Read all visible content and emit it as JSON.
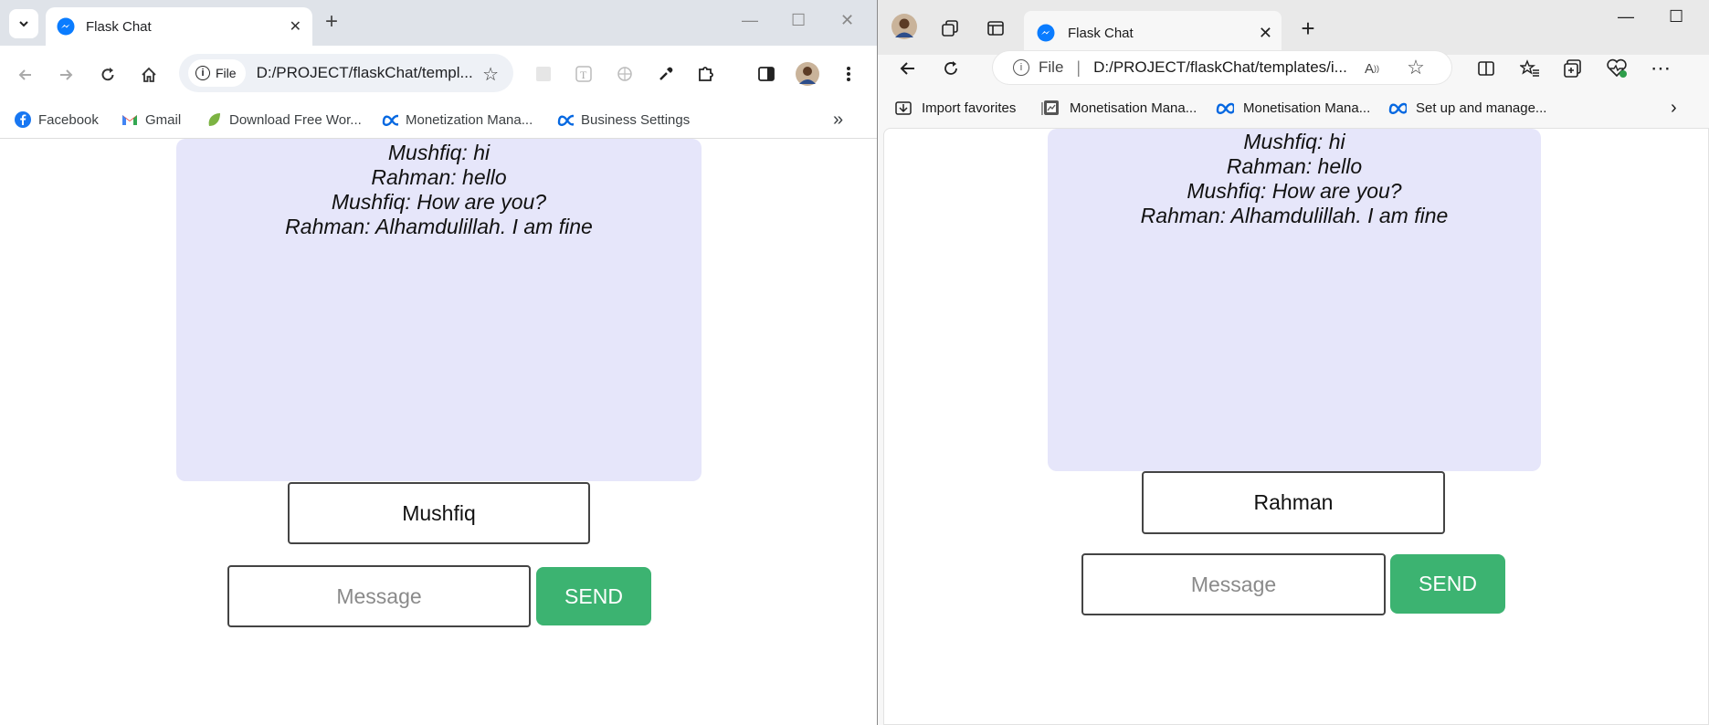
{
  "chrome": {
    "tab_title": "Flask Chat",
    "address_chip": "File",
    "url": "D:/PROJECT/flaskChat/templ...",
    "bookmarks": [
      {
        "label": "Facebook",
        "icon": "facebook-icon"
      },
      {
        "label": "Gmail",
        "icon": "gmail-icon"
      },
      {
        "label": "Download Free Wor...",
        "icon": "leaf-icon"
      },
      {
        "label": "Monetization Mana...",
        "icon": "meta-icon"
      },
      {
        "label": "Business Settings",
        "icon": "meta-icon"
      }
    ],
    "chat": {
      "messages": [
        "Mushfiq: hi",
        "Rahman: hello",
        "Mushfiq: How are you?",
        "Rahman: Alhamdulillah. I am fine"
      ],
      "username": "Mushfiq",
      "message_placeholder": "Message",
      "send_label": "SEND"
    }
  },
  "edge": {
    "tab_title": "Flask Chat",
    "address_label": "File",
    "url": "D:/PROJECT/flaskChat/templates/i...",
    "favorites": [
      {
        "label": "Import favorites",
        "icon": "import-icon"
      },
      {
        "label": "Monetisation Mana...",
        "icon": "page-icon"
      },
      {
        "label": "Monetisation Mana...",
        "icon": "meta-icon"
      },
      {
        "label": "Set up and manage...",
        "icon": "meta-icon"
      }
    ],
    "chat": {
      "messages": [
        "Mushfiq: hi",
        "Rahman: hello",
        "Mushfiq: How are you?",
        "Rahman: Alhamdulillah. I am fine"
      ],
      "username": "Rahman",
      "message_placeholder": "Message",
      "send_label": "SEND"
    }
  },
  "colors": {
    "chat_background": "#e6e6fa",
    "send_button": "#3cb371",
    "messenger_blue": "#0a7cff",
    "meta_blue": "#0668e1"
  }
}
